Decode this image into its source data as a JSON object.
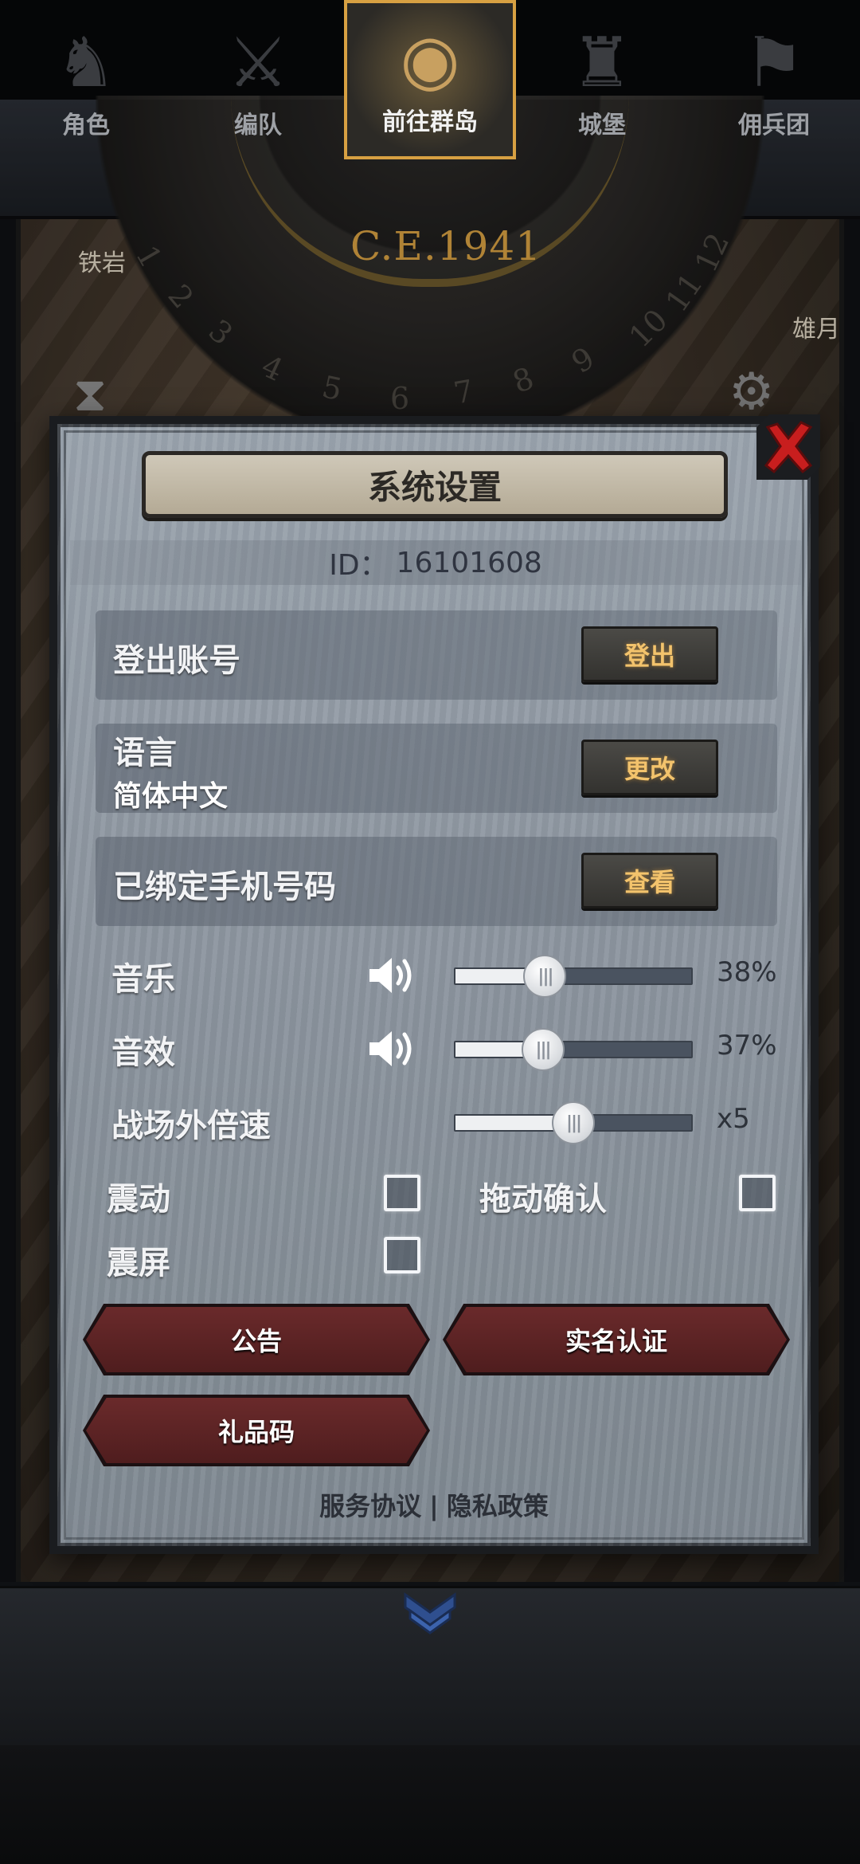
{
  "background": {
    "era": "C.E.1941",
    "dial_numbers": [
      "1",
      "2",
      "3",
      "4",
      "5",
      "6",
      "7",
      "8",
      "9",
      "10",
      "11",
      "12"
    ],
    "map_labels": [
      "铁岩",
      "雄月"
    ]
  },
  "dialog": {
    "title": "系统设置",
    "id_label": "ID：",
    "id_value": "16101608",
    "logout": {
      "label": "登出账号",
      "button": "登出"
    },
    "language": {
      "label": "语言",
      "value": "简体中文",
      "button": "更改"
    },
    "phone": {
      "label": "已绑定手机号码",
      "button": "查看"
    },
    "music": {
      "label": "音乐",
      "value_text": "38%",
      "level": 0.38
    },
    "sfx": {
      "label": "音效",
      "value_text": "37%",
      "level": 0.37
    },
    "speed": {
      "label": "战场外倍速",
      "value_text": "x5",
      "level": 0.5
    },
    "vibration": {
      "label": "震动",
      "checked": false
    },
    "drag_confirm": {
      "label": "拖动确认",
      "checked": false
    },
    "screen_shake": {
      "label": "震屏",
      "checked": false
    },
    "buttons": {
      "announcement": "公告",
      "real_name": "实名认证",
      "gift_code": "礼品码"
    },
    "links": {
      "service": "服务协议",
      "separator": "|",
      "privacy": "隐私政策"
    }
  },
  "bottom_nav": {
    "items": [
      {
        "label": "角色",
        "icon": "knight-icon"
      },
      {
        "label": "编队",
        "icon": "squad-icon"
      },
      {
        "label": "前往群岛",
        "icon": "island-icon",
        "active": true
      },
      {
        "label": "城堡",
        "icon": "castle-icon"
      },
      {
        "label": "佣兵团",
        "icon": "mercenary-icon"
      }
    ]
  },
  "colors": {
    "accent_gold": "#d7a042",
    "button_red": "#6a2a2b",
    "close_red": "#c81e1e"
  }
}
